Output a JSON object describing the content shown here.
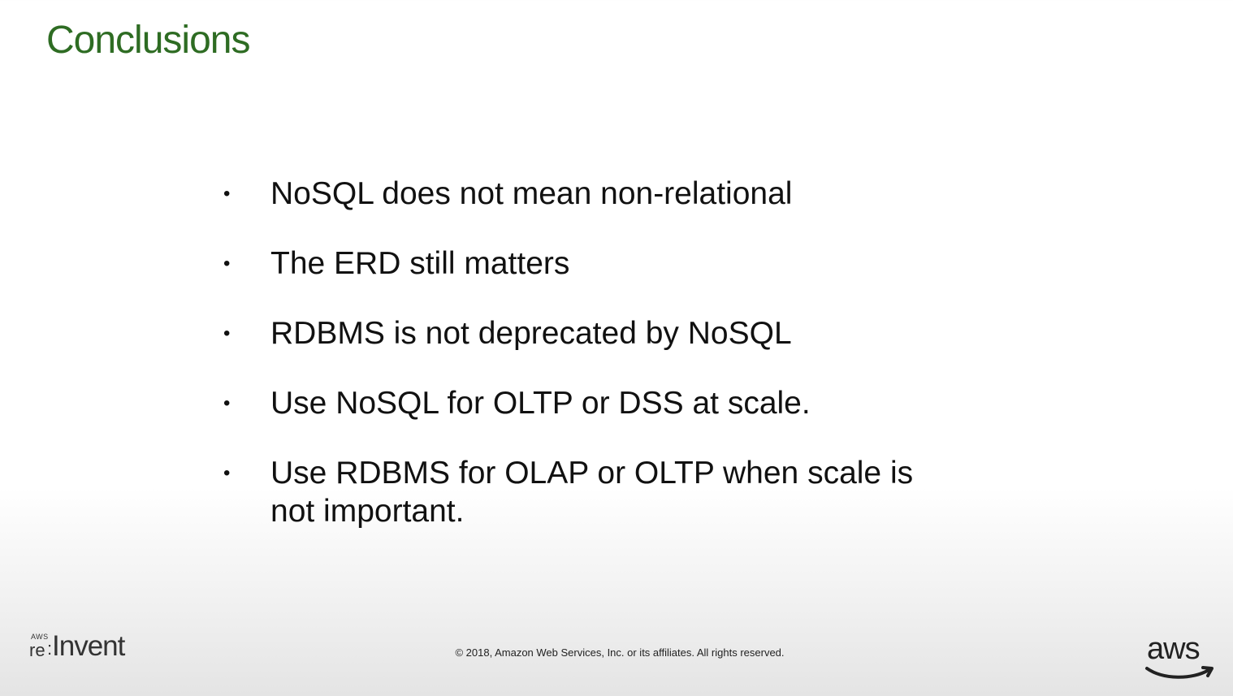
{
  "slide": {
    "title": "Conclusions",
    "bullets": [
      {
        "text": "NoSQL does not mean non-relational"
      },
      {
        "text": "The ERD still matters"
      },
      {
        "text": "RDBMS is not deprecated by NoSQL"
      },
      {
        "text": "Use NoSQL for OLTP or DSS at scale."
      },
      {
        "text": "Use RDBMS for OLAP or OLTP when scale is not important."
      }
    ]
  },
  "footer": {
    "event_logo": {
      "aws_small": "AWS",
      "re_text": "re",
      "colon_text": ":",
      "invent_text": "Invent"
    },
    "copyright": "© 2018, Amazon Web Services, Inc. or its affiliates. All rights reserved.",
    "brand_logo": {
      "word": "aws",
      "icon": "smile-arrow-icon"
    }
  },
  "colors": {
    "title": "#2e6c23",
    "body_text": "#111111",
    "footer_text": "#222222",
    "background_top": "#ffffff",
    "background_bottom": "#e4e4e4"
  }
}
